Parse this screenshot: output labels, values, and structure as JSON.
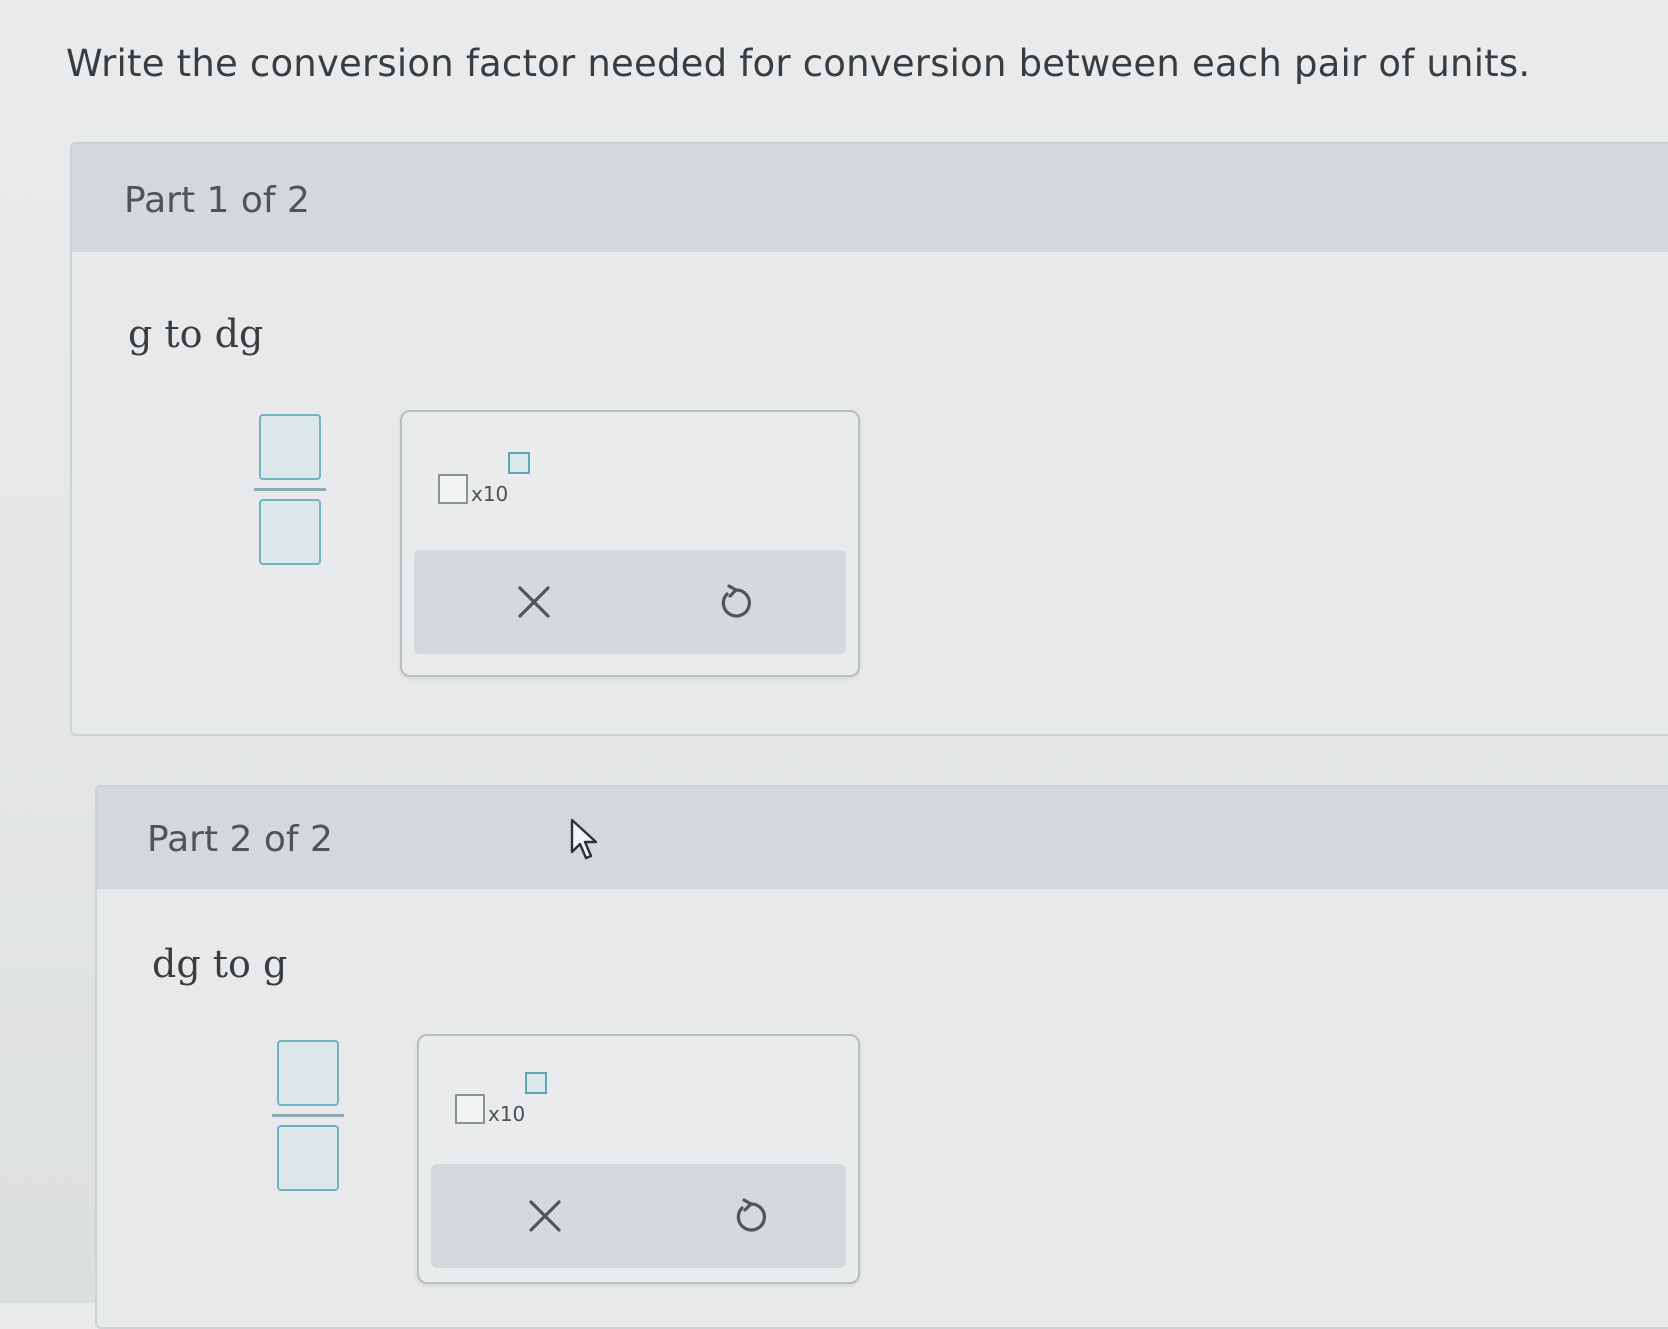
{
  "instruction": "Write the conversion factor needed for conversion between each pair of units.",
  "parts": [
    {
      "title": "Part 1 of 2",
      "prompt": "g to dg",
      "sci_label": "x10",
      "buttons": {
        "clear": "clear-icon",
        "undo": "undo-icon"
      }
    },
    {
      "title": "Part 2 of 2",
      "prompt": "dg to g",
      "sci_label": "x10",
      "buttons": {
        "clear": "clear-icon",
        "undo": "undo-icon"
      }
    }
  ],
  "colors": {
    "accent": "#6fb3c4",
    "header_bg": "#d3d8da",
    "panel_bg": "#e7e9ea"
  }
}
